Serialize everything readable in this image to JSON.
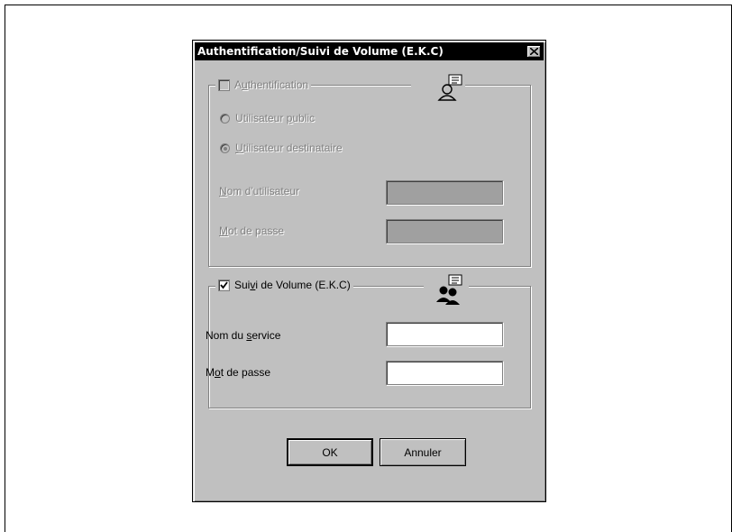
{
  "dialog": {
    "title": "Authentification/Suivi de Volume  (E.K.C)"
  },
  "auth": {
    "checkbox_pre": "A",
    "checkbox_acc": "u",
    "checkbox_post": "thentification",
    "checked": false,
    "enabled": false,
    "radio_public_pre": "Utilisateur ",
    "radio_public_acc": "p",
    "radio_public_post": "ublic",
    "radio_dest_pre": "",
    "radio_dest_acc": "U",
    "radio_dest_post": "tilisateur destinataire",
    "username_label_pre": "",
    "username_label_acc": "N",
    "username_label_post": "om d'utilisateur",
    "username_value": "",
    "password_label_pre": "",
    "password_label_acc": "M",
    "password_label_post": "ot de passe",
    "password_value": "",
    "icon": "user-card-icon"
  },
  "volume": {
    "checkbox_pre": "Sui",
    "checkbox_acc": "v",
    "checkbox_post": "i de Volume  (E.K.C)",
    "checked": true,
    "enabled": true,
    "service_label_pre": "Nom du ",
    "service_label_acc": "s",
    "service_label_post": "ervice",
    "service_value": "",
    "password_label_pre": "M",
    "password_label_acc": "o",
    "password_label_post": "t de passe",
    "password_value": "",
    "icon": "group-users-icon"
  },
  "buttons": {
    "ok": "OK",
    "cancel": "Annuler"
  }
}
